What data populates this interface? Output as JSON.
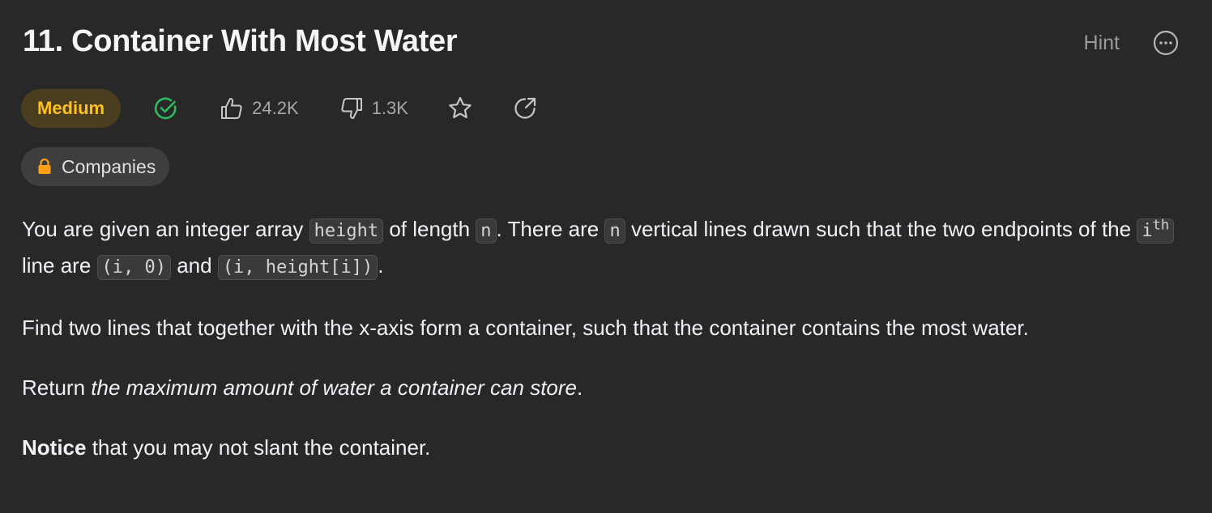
{
  "problem": {
    "title": "11. Container With Most Water",
    "difficulty": "Medium",
    "likes": "24.2K",
    "dislikes": "1.3K",
    "companies_label": "Companies"
  },
  "header": {
    "hint_label": "Hint"
  },
  "description": {
    "p1_a": "You are given an integer array ",
    "code_height": "height",
    "p1_b": " of length ",
    "code_n1": "n",
    "p1_c": ". There are ",
    "code_n2": "n",
    "p1_d": " vertical lines drawn such that the two endpoints of the ",
    "code_i": "i",
    "sup_th": "th",
    "p1_e": " line are ",
    "code_point1": "(i, 0)",
    "p1_f": " and ",
    "code_point2": "(i, height[i])",
    "p1_g": ".",
    "p2": "Find two lines that together with the x-axis form a container, such that the container contains the most water.",
    "p3_a": "Return ",
    "p3_em": "the maximum amount of water a container can store",
    "p3_b": ".",
    "p4_strong": "Notice",
    "p4_rest": " that you may not slant the container."
  },
  "colors": {
    "background": "#282828",
    "medium": "#ffc01e",
    "solved_green": "#2cbb5d"
  },
  "icons": [
    "solved-check-icon",
    "thumbs-up-icon",
    "thumbs-down-icon",
    "star-icon",
    "share-icon",
    "more-icon",
    "lock-icon"
  ]
}
